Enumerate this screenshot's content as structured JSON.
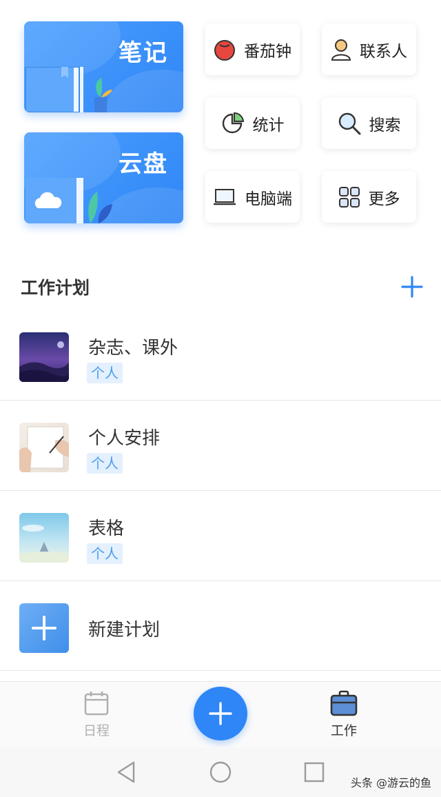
{
  "quick_cards": {
    "notes_label": "笔记",
    "cloud_label": "云盘"
  },
  "tools": [
    {
      "label": "番茄钟",
      "icon": "tomato-icon"
    },
    {
      "label": "联系人",
      "icon": "contact-person-icon"
    },
    {
      "label": "统计",
      "icon": "pie-chart-icon"
    },
    {
      "label": "搜索",
      "icon": "search-icon"
    },
    {
      "label": "电脑端",
      "icon": "laptop-icon"
    },
    {
      "label": "更多",
      "icon": "grid-more-icon"
    }
  ],
  "plans_section": {
    "title": "工作计划",
    "add_icon": "plus-icon"
  },
  "plans": [
    {
      "name": "杂志、课外",
      "tag": "个人",
      "thumb": "night-sky-thumbnail"
    },
    {
      "name": "个人安排",
      "tag": "个人",
      "thumb": "notebook-hand-thumbnail"
    },
    {
      "name": "表格",
      "tag": "个人",
      "thumb": "sky-landscape-thumbnail"
    }
  ],
  "new_plan": {
    "label": "新建计划",
    "icon": "plus-icon"
  },
  "tabbar": {
    "schedule_label": "日程",
    "work_label": "工作",
    "active": "工作"
  },
  "watermark": "头条 @游云的鱼",
  "colors": {
    "accent": "#2f86f6",
    "tag_bg": "#e4f0fd",
    "tag_text": "#4a9bf0"
  }
}
